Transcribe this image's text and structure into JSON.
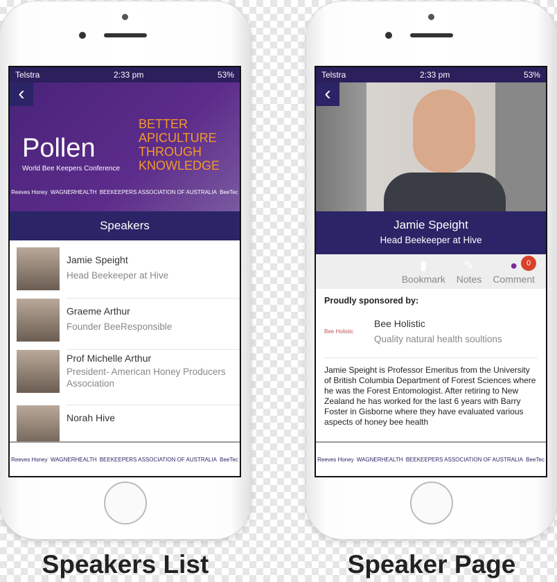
{
  "status": {
    "carrier": "Telstra",
    "time": "2:33 pm",
    "battery": "53%"
  },
  "sponsor_logos": [
    "Reeves Honey",
    "WAGNERHEALTH",
    "BEEKEEPERS ASSOCIATION OF AUSTRALIA",
    "BeeTec"
  ],
  "list_screen": {
    "brand": "Pollen",
    "brand_sub": "World Bee Keepers Conference",
    "tagline": [
      "BETTER",
      "APICULTURE",
      "THROUGH",
      "KNOWLEDGE"
    ],
    "title": "Speakers",
    "speakers": [
      {
        "name": "Jamie Speight",
        "role": "Head Beekeeper at Hive"
      },
      {
        "name": "Graeme Arthur",
        "role": "Founder BeeResponsible"
      },
      {
        "name": "Prof Michelle Arthur",
        "role": " President- American Honey Producers Association"
      },
      {
        "name": "Norah Hive",
        "role": ""
      }
    ]
  },
  "speaker_screen": {
    "name": "Jamie Speight",
    "role": "Head Beekeeper at Hive",
    "actions": {
      "bookmark": "Bookmark",
      "notes": "Notes",
      "comment": "Comment",
      "comment_count": "0"
    },
    "sponsored_label": "Proudly sponsored by:",
    "sponsor_logo": "Bee Holistic",
    "sponsor_name": "Bee Holistic",
    "sponsor_desc": "Quality natural health soultions",
    "bio": "Jamie Speight is Professor Emeritus from the University of British Columbia Department of Forest Sciences where he was the Forest Entomologist. After retiring to New Zealand he has worked for the last 6 years with Barry Foster in Gisborne where they have evaluated various aspects of honey bee health"
  },
  "captions": [
    "Speakers List",
    "Speaker Page"
  ],
  "colors": {
    "header": "#2b2466",
    "tagline": "#f39a2c",
    "badge": "#d9412a"
  }
}
